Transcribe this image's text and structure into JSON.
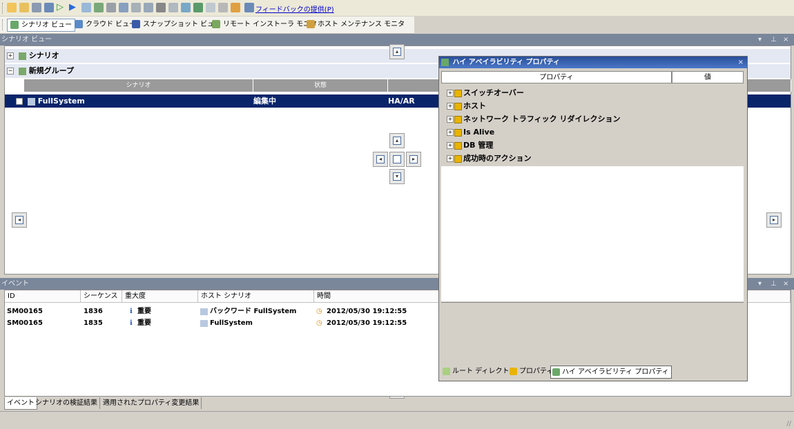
{
  "toolbar": {
    "feedback_link": "フィードバックの提供(P)"
  },
  "views": {
    "tabs": [
      {
        "label": "シナリオ ビュー",
        "active": true
      },
      {
        "label": "クラウド ビュー"
      },
      {
        "label": "スナップショット ビュー"
      },
      {
        "label": "リモート インストーラ モニタ"
      },
      {
        "label": "ホスト メンテナンス モニタ"
      }
    ]
  },
  "scenario_panel": {
    "title": "シナリオ ビュー",
    "groups": [
      "シナリオ",
      "新規グループ"
    ],
    "columns": [
      "シナリオ",
      "状態"
    ],
    "row": {
      "name": "FullSystem",
      "status": "編集中",
      "type": "HA/AR"
    }
  },
  "events_panel": {
    "title": "イベント",
    "columns": [
      "ID",
      "シーケンス",
      "重大度",
      "ホスト シナリオ",
      "時間"
    ],
    "rows": [
      {
        "id": "SM00165",
        "seq": "1836",
        "severity": "重要",
        "scenario": "バックワード FullSystem",
        "time": "2012/05/30 19:12:55"
      },
      {
        "id": "SM00165",
        "seq": "1835",
        "severity": "重要",
        "scenario": "FullSystem",
        "time": "2012/05/30 19:12:55"
      }
    ],
    "bottom_tabs": [
      "イベント",
      "シナリオの検証結果",
      "適用されたプロパティ変更結果"
    ]
  },
  "property_window": {
    "title": "ハイ アベイラビリティ プロパティ",
    "col_property": "プロパティ",
    "col_value": "値",
    "items": [
      "スイッチオーバー",
      "ホスト",
      "ネットワーク トラフィック リダイレクション",
      "Is Alive",
      "DB 管理",
      "成功時のアクション"
    ],
    "tabs": [
      "ルート ディレクトリ",
      "プロパティ",
      "ハイ アベイラビリティ プロパティ"
    ]
  },
  "colors": {
    "selection": "#0a246a",
    "panel_header": "#7a869a",
    "link": "#0000cc"
  }
}
